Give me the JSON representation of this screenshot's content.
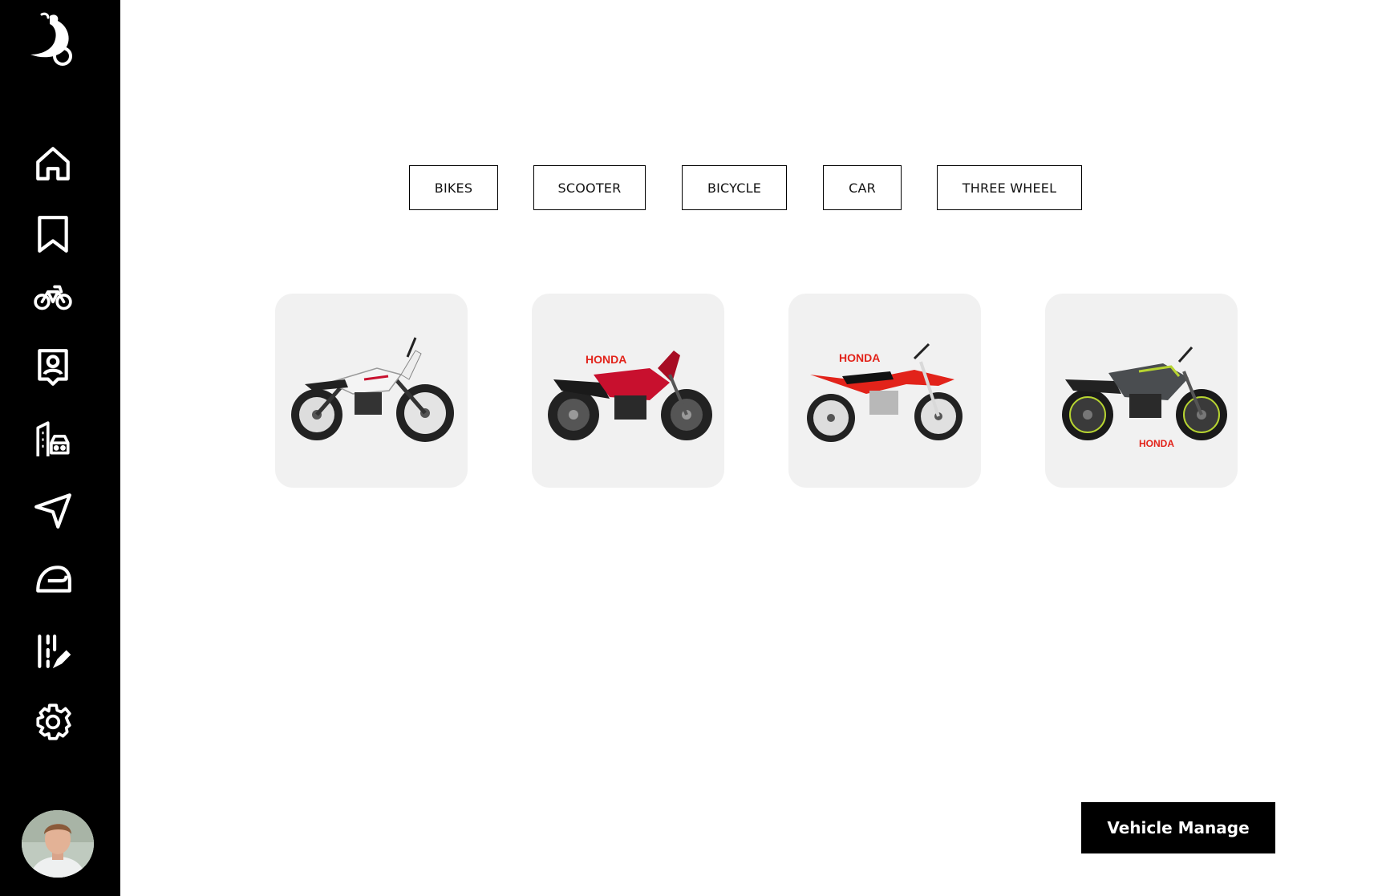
{
  "sidebar": {
    "logo": "scooter-logo",
    "items": [
      {
        "name": "home",
        "icon": "home-icon"
      },
      {
        "name": "bookmarks",
        "icon": "bookmark-icon"
      },
      {
        "name": "bicycle",
        "icon": "bicycle-icon"
      },
      {
        "name": "profile",
        "icon": "contact-badge-icon"
      },
      {
        "name": "dealership",
        "icon": "building-car-icon"
      },
      {
        "name": "navigation",
        "icon": "send-arrow-icon"
      },
      {
        "name": "helmet",
        "icon": "helmet-icon"
      },
      {
        "name": "edit-records",
        "icon": "edit-list-icon"
      },
      {
        "name": "settings",
        "icon": "gear-icon"
      }
    ],
    "avatar": "user-avatar"
  },
  "tabs": [
    {
      "label": "BIKES"
    },
    {
      "label": "SCOOTER"
    },
    {
      "label": "BICYCLE"
    },
    {
      "label": "CAR"
    },
    {
      "label": "THREE WHEEL"
    }
  ],
  "vehicles": [
    {
      "image": "white-adventure-motorcycle",
      "brand_text": "",
      "color": "#f2f2f2"
    },
    {
      "image": "red-honda-motorcycle",
      "brand_text": "HONDA",
      "color": "#c8102e"
    },
    {
      "image": "red-honda-dirt-bike",
      "brand_text": "HONDA",
      "color": "#e2231a"
    },
    {
      "image": "grey-honda-motorcycle",
      "brand_text": "HONDA",
      "color": "#4a4d50"
    }
  ],
  "actions": {
    "manage_label": "Vehicle Manage"
  },
  "theme": {
    "sidebar_bg": "#000000",
    "card_bg": "#f1f1f1",
    "accent": "#000000"
  }
}
